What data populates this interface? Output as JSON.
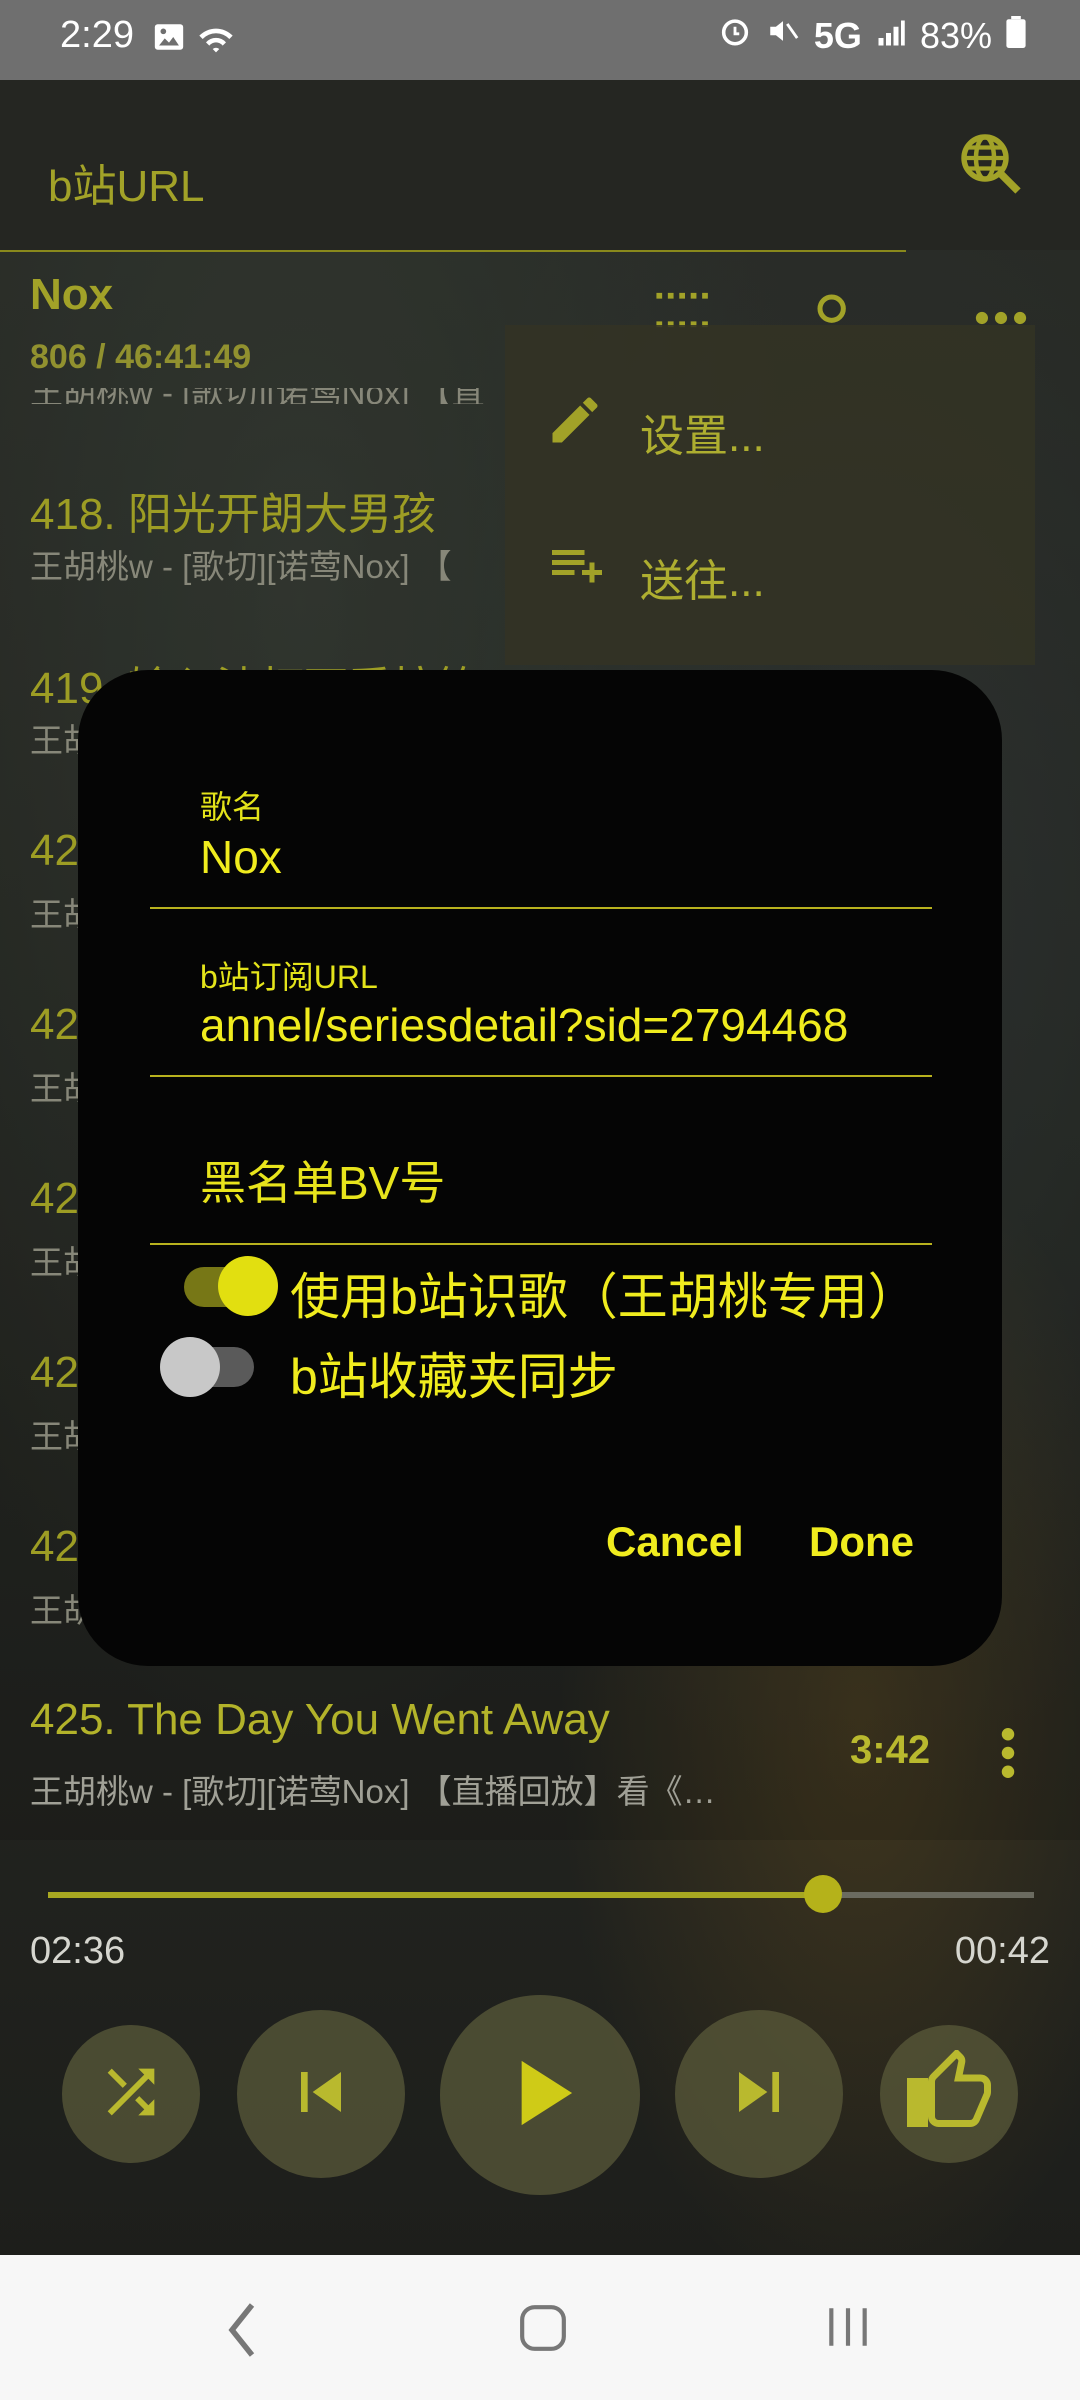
{
  "status": {
    "time": "2:29",
    "network": "5G",
    "battery": "83%"
  },
  "search": {
    "placeholder": "b站URL"
  },
  "playlist": {
    "name": "Nox",
    "count": "806 / 46:41:49"
  },
  "songs": [
    {
      "title": "418. 阳光开朗大男孩",
      "subtitle": "王胡桃w - [歌切][诺莺Nox] 【"
    },
    {
      "title": "419. 输入法打可爱按第",
      "subtitle": "王胡"
    },
    {
      "title": "42",
      "subtitle": "王胡"
    },
    {
      "title": "42",
      "subtitle": "王胡"
    },
    {
      "title": "42",
      "subtitle": "王胡"
    },
    {
      "title": "42",
      "subtitle": "王胡"
    },
    {
      "title": "42",
      "subtitle": "王胡"
    },
    {
      "title": "425. The Day You Went Away",
      "subtitle": "王胡桃w - [歌切][诺莺Nox] 【直播回放】看《…",
      "duration": "3:42"
    }
  ],
  "menu": {
    "items": [
      {
        "label": "设置...",
        "icon": "pencil-icon"
      },
      {
        "label": "送往...",
        "icon": "playlist-add-icon"
      }
    ]
  },
  "dialog": {
    "name_label": "歌名",
    "name_value": "Nox",
    "url_label": "b站订阅URL",
    "url_value": "annel/seriesdetail?sid=2794468",
    "blacklist_placeholder": "黑名单BV号",
    "switch1_label": "使用b站识歌（王胡桃专用）",
    "switch1_on": true,
    "switch2_label": "b站收藏夹同步",
    "switch2_on": false,
    "cancel": "Cancel",
    "done": "Done"
  },
  "player": {
    "current": "02:36",
    "remaining": "00:42",
    "progress": 0.786
  },
  "colors": {
    "accent": "#b9b92e",
    "dialog_text": "#f0ec1e",
    "dialog_bg": "#050505"
  }
}
